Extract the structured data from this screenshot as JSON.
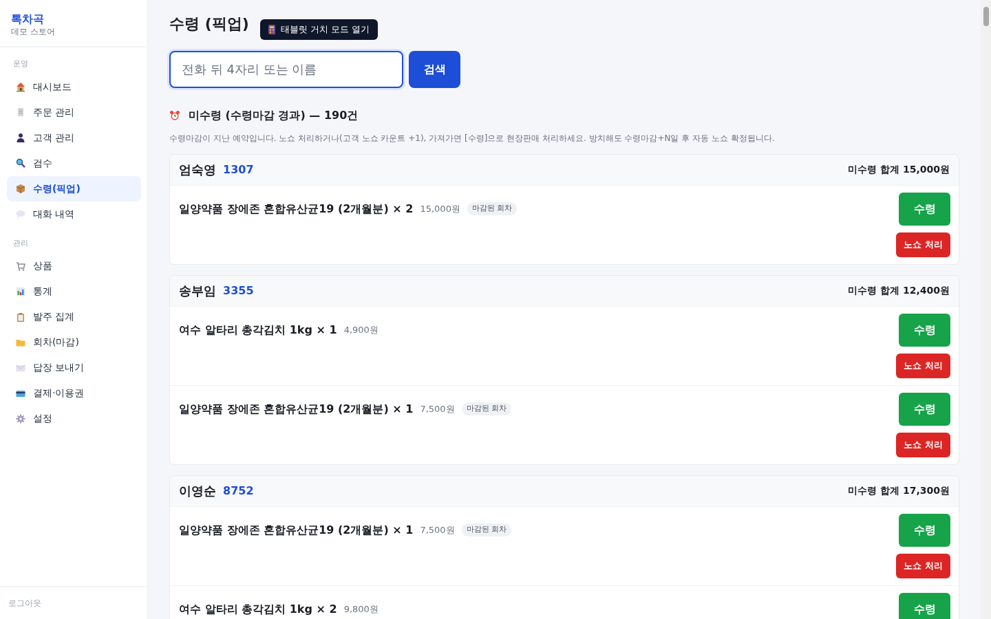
{
  "sidebar": {
    "brand": "톡차곡",
    "store": "데모 스토어",
    "sections": [
      {
        "title": "운영",
        "items": [
          {
            "label": "대시보드",
            "selected": false
          },
          {
            "label": "주문 관리",
            "selected": false
          },
          {
            "label": "고객 관리",
            "selected": false
          },
          {
            "label": "검수",
            "selected": false
          },
          {
            "label": "수령(픽업)",
            "selected": true
          },
          {
            "label": "대화 내역",
            "selected": false
          }
        ]
      },
      {
        "title": "관리",
        "items": [
          {
            "label": "상품",
            "selected": false
          },
          {
            "label": "통계",
            "selected": false
          },
          {
            "label": "발주 집계",
            "selected": false
          },
          {
            "label": "회차(마감)",
            "selected": false
          },
          {
            "label": "답장 보내기",
            "selected": false
          },
          {
            "label": "결제·이용권",
            "selected": false
          },
          {
            "label": "설정",
            "selected": false
          }
        ]
      }
    ],
    "logout": "로그아웃"
  },
  "header": {
    "title": "수령 (픽업)",
    "tablet_button": "태블릿 거치 모드 열기"
  },
  "search": {
    "placeholder": "전화 뒤 4자리 또는 이름",
    "button": "검색"
  },
  "overdue": {
    "title": "미수령 (수령마감 경과) — 190건",
    "description": "수령마감이 지난 예약입니다. 노쇼 처리하거나(고객 노쇼 카운트 +1), 가져가면 [수령]으로 현장판매 처리하세요. 방치해도 수령마감+N일 후 자동 노쇼 확정됩니다."
  },
  "customers": [
    {
      "name": "엄숙영",
      "code": "1307",
      "total": "미수령 합계 15,000원",
      "items": [
        {
          "product": "일양약품 장에존 혼합유산균19 (2개월분) × 2",
          "price": "15,000원",
          "tag": "마감된 회차",
          "pickup_button": "수령",
          "noshow_button": "노쇼 처리"
        }
      ]
    },
    {
      "name": "송부임",
      "code": "3355",
      "total": "미수령 합계 12,400원",
      "items": [
        {
          "product": "여수 알타리 총각김치 1kg × 1",
          "price": "4,900원",
          "pickup_button": "수령",
          "noshow_button": "노쇼 처리"
        },
        {
          "product": "일양약품 장에존 혼합유산균19 (2개월분) × 1",
          "price": "7,500원",
          "tag": "마감된 회차",
          "pickup_button": "수령",
          "noshow_button": "노쇼 처리"
        }
      ]
    },
    {
      "name": "이영순",
      "code": "8752",
      "total": "미수령 합계 17,300원",
      "items": [
        {
          "product": "일양약품 장에존 혼합유산균19 (2개월분) × 1",
          "price": "7,500원",
          "tag": "마감된 회차",
          "pickup_button": "수령",
          "noshow_button": "노쇼 처리"
        },
        {
          "product": "여수 알타리 총각김치 1kg × 2",
          "price": "9,800원",
          "pickup_button": "수령"
        }
      ]
    }
  ]
}
